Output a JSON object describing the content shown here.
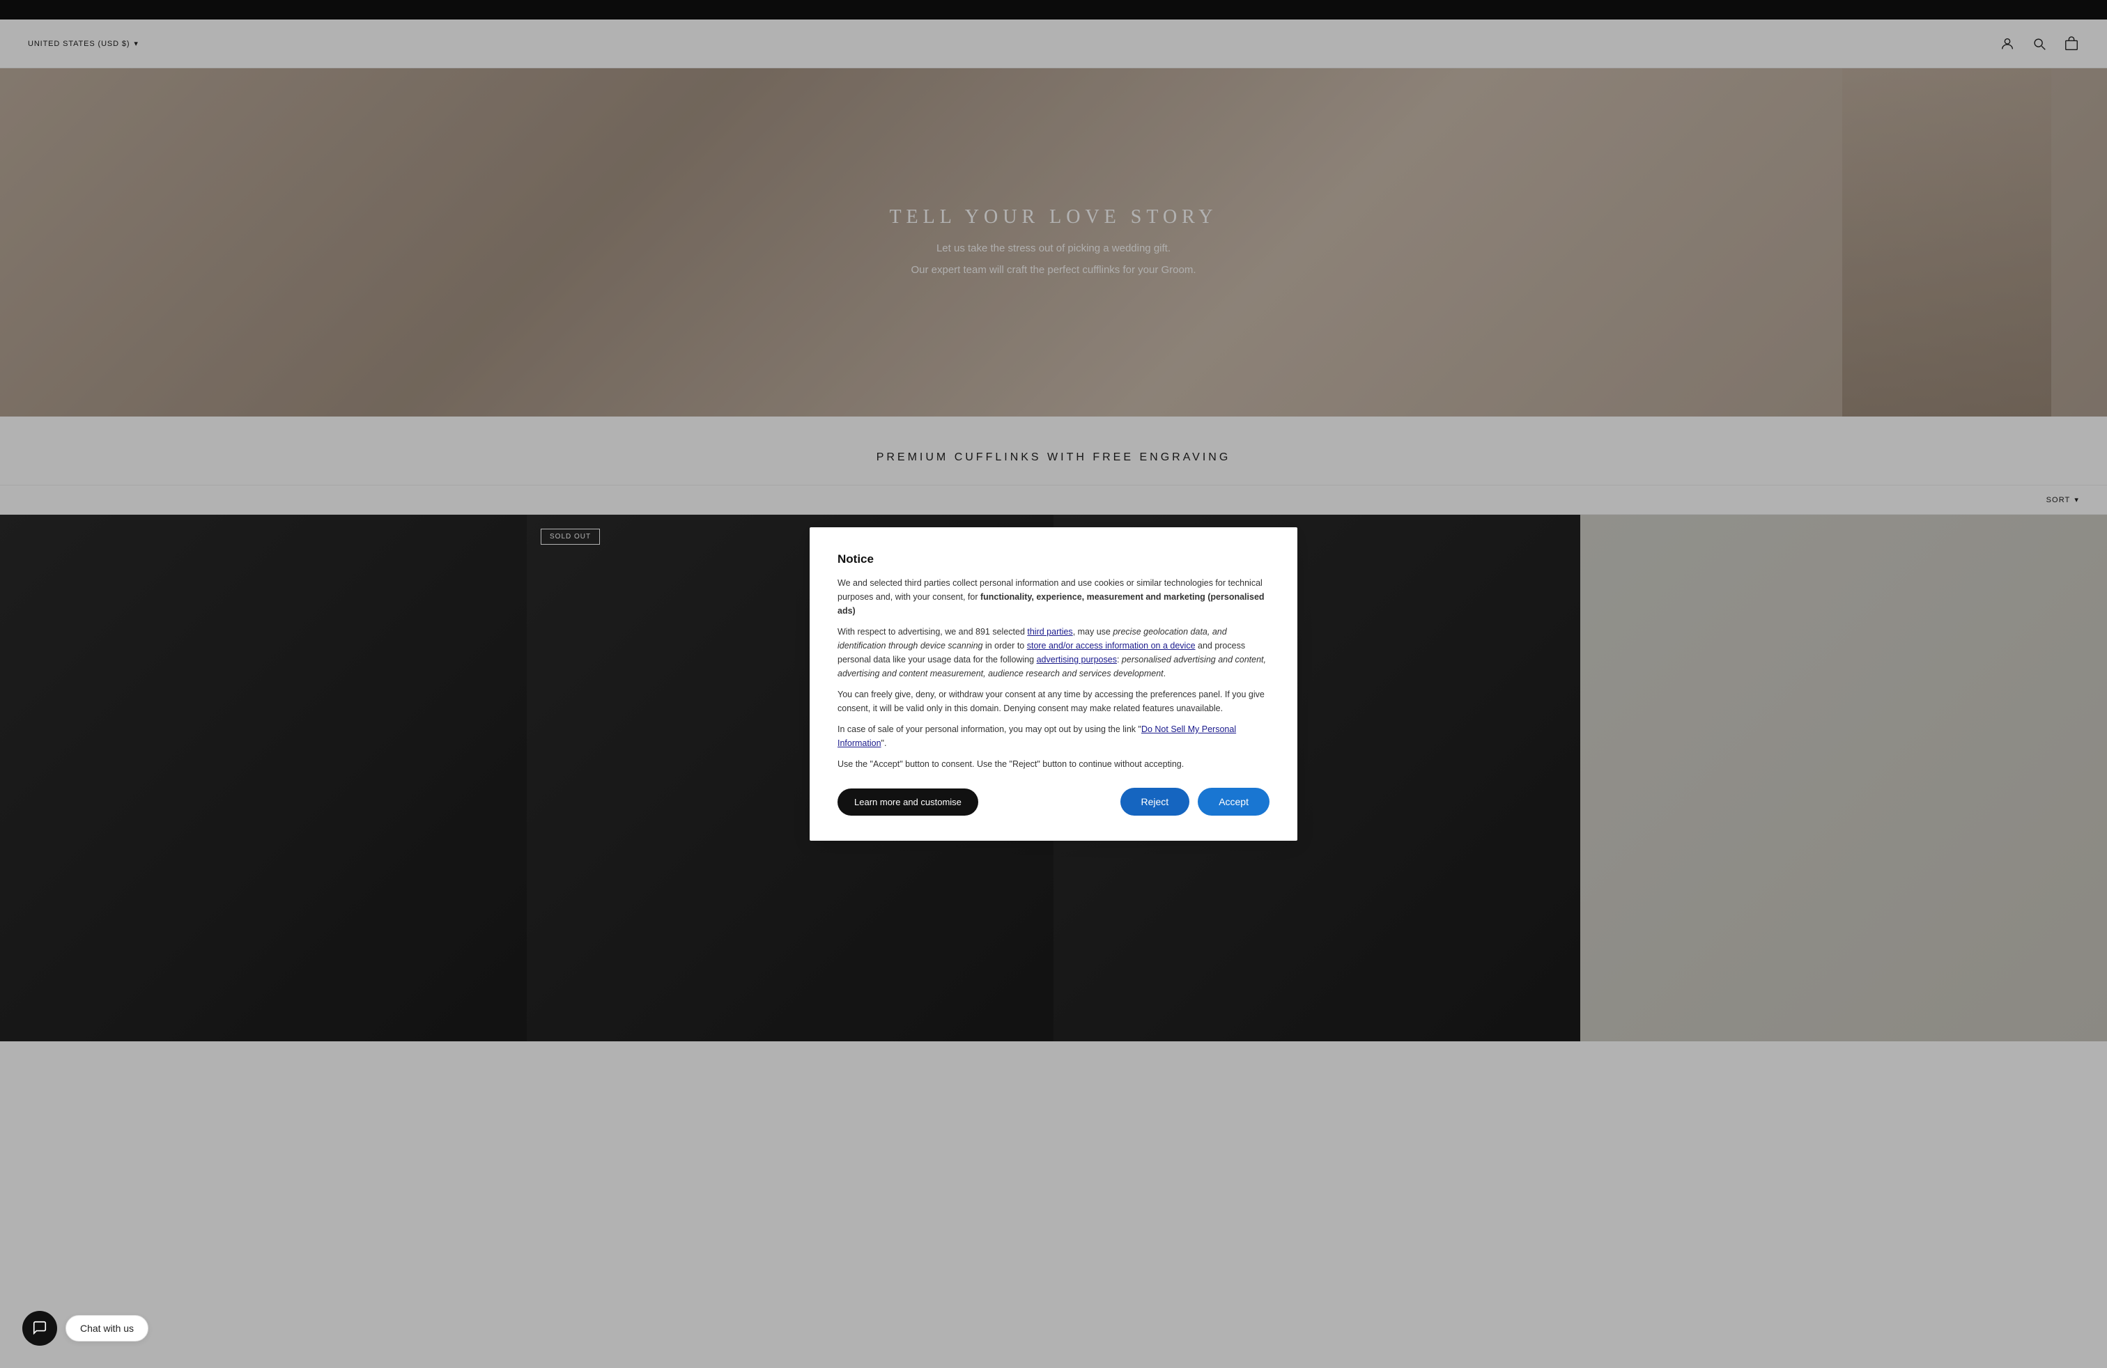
{
  "topBar": {
    "visible": true
  },
  "header": {
    "regionLabel": "UNITED STATES (USD $)",
    "dropdownIcon": "▾",
    "icons": {
      "user": "user-icon",
      "search": "search-icon",
      "cart": "cart-icon"
    }
  },
  "hero": {
    "title": "TELL YOUR LOVE STORY",
    "subtitle": "Let us take the stress out of picking a wedding gift.",
    "description": "Our expert team will craft the perfect cufflinks for your Groom."
  },
  "sectionTitle": "PREMIUM CUFFLINKS WITH FREE ENGRAVING",
  "sortBar": {
    "label": "SORT",
    "icon": "chevron-down-icon"
  },
  "products": [
    {
      "id": 1,
      "soldOut": false,
      "colorClass": "dark"
    },
    {
      "id": 2,
      "soldOut": true,
      "colorClass": "dark",
      "badge": "SOLD OUT"
    },
    {
      "id": 3,
      "soldOut": false,
      "colorClass": "dark"
    },
    {
      "id": 4,
      "soldOut": false,
      "colorClass": "light"
    }
  ],
  "cookieNotice": {
    "title": "Notice",
    "body": {
      "line1": "We and selected third parties collect personal information and use cookies or similar technologies for technical purposes and, with your consent, for",
      "line1Bold": "functionality, experience, measurement and marketing (personalised ads)",
      "line2Start": "With respect to advertising, we and 891 selected ",
      "line2Link": "third parties",
      "line2Mid": ", may use ",
      "line2Italic": "precise geolocation data, and identification through device scanning",
      "line2End": " in order to ",
      "line2Link2": "store and/or access information on a device",
      "line2End2": " and process personal data like your usage data for the following ",
      "line2Link3": "advertising purposes",
      "line2End3": ": ",
      "line2Italic2": "personalised advertising and content, advertising and content measurement, audience research and services development",
      "line2End4": ".",
      "line3": "You can freely give, deny, or withdraw your consent at any time by accessing the preferences panel. If you give consent, it will be valid only in this domain. Denying consent may make related features unavailable.",
      "line4Start": "In case of sale of your personal information, you may opt out by using the link \"",
      "line4Link": "Do Not Sell My Personal Information",
      "line4End": "\".",
      "line5": "Use the \"Accept\" button to consent. Use the \"Reject\" button to continue without accepting."
    },
    "buttons": {
      "learnMore": "Learn more and customise",
      "reject": "Reject",
      "accept": "Accept"
    }
  },
  "chatWidget": {
    "label": "Chat with us",
    "icon": "chat-icon"
  }
}
